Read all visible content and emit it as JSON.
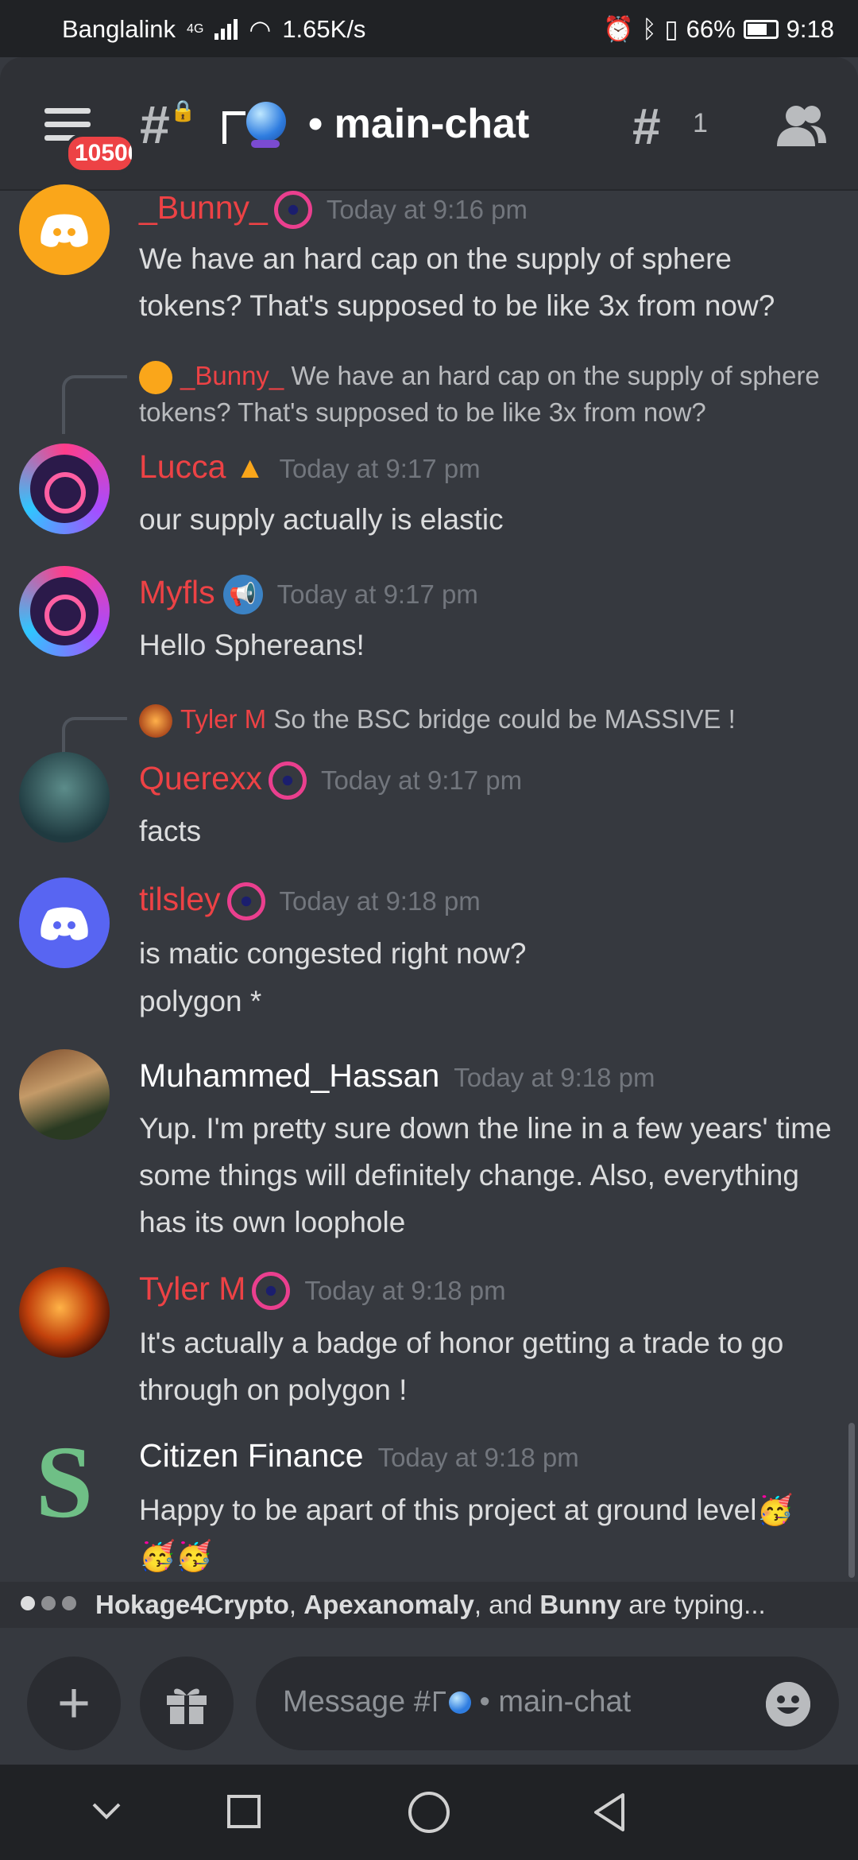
{
  "status": {
    "carrier": "Banglalink",
    "net": "4G",
    "speed": "1.65K/s",
    "battery": "66%",
    "time": "9:18"
  },
  "header": {
    "unread_badge": "10506",
    "channel_name": "• main-chat",
    "threads_count": "1"
  },
  "messages": [
    {
      "author": "_Bunny_",
      "author_color": "#ed4245",
      "time": "Today at 9:16 pm",
      "text": "We have an hard cap on the supply of sphere tokens? That's supposed to be like 3x from now?"
    },
    {
      "reply_author": "_Bunny_",
      "reply_text": "We have an hard cap on the supply of sphere tokens? That's supposed to be like 3x from now?",
      "author": "Lucca",
      "author_color": "#ed4245",
      "time": "Today at 9:17 pm",
      "text": "our supply actually is elastic"
    },
    {
      "author": "Myfls",
      "author_color": "#ed4245",
      "time": "Today at 9:17 pm",
      "text": "Hello Sphereans!"
    },
    {
      "reply_author": "Tyler M",
      "reply_text": "So the BSC bridge could be MASSIVE !",
      "author": "Querexx",
      "author_color": "#ed4245",
      "time": "Today at 9:17 pm",
      "text": "facts"
    },
    {
      "author": "tilsley",
      "author_color": "#ed4245",
      "time": "Today at 9:18 pm",
      "text": "is matic congested right now?",
      "text2": "polygon *"
    },
    {
      "author": "Muhammed_Hassan",
      "author_color": "#ffffff",
      "time": "Today at 9:18 pm",
      "text": "Yup. I'm pretty sure down the line in a few years' time some things will definitely change. Also, everything has its own loophole"
    },
    {
      "author": "Tyler M",
      "author_color": "#ed4245",
      "time": "Today at 9:18 pm",
      "text": "It's actually a badge of honor getting a trade to go through on polygon !"
    },
    {
      "author": "Citizen Finance",
      "author_color": "#ffffff",
      "time": "Today at 9:18 pm",
      "text": "Happy to be apart of this project at ground level🥳",
      "text2": "🥳🥳"
    }
  ],
  "typing": {
    "user1": "Hokage4Crypto",
    "sep1": ", ",
    "user2": "Apexanomaly",
    "sep2": ", and ",
    "user3": "Bunny",
    "suffix": " are typing..."
  },
  "composer": {
    "placeholder_prefix": "Message #",
    "placeholder_channel": "• main-chat"
  }
}
